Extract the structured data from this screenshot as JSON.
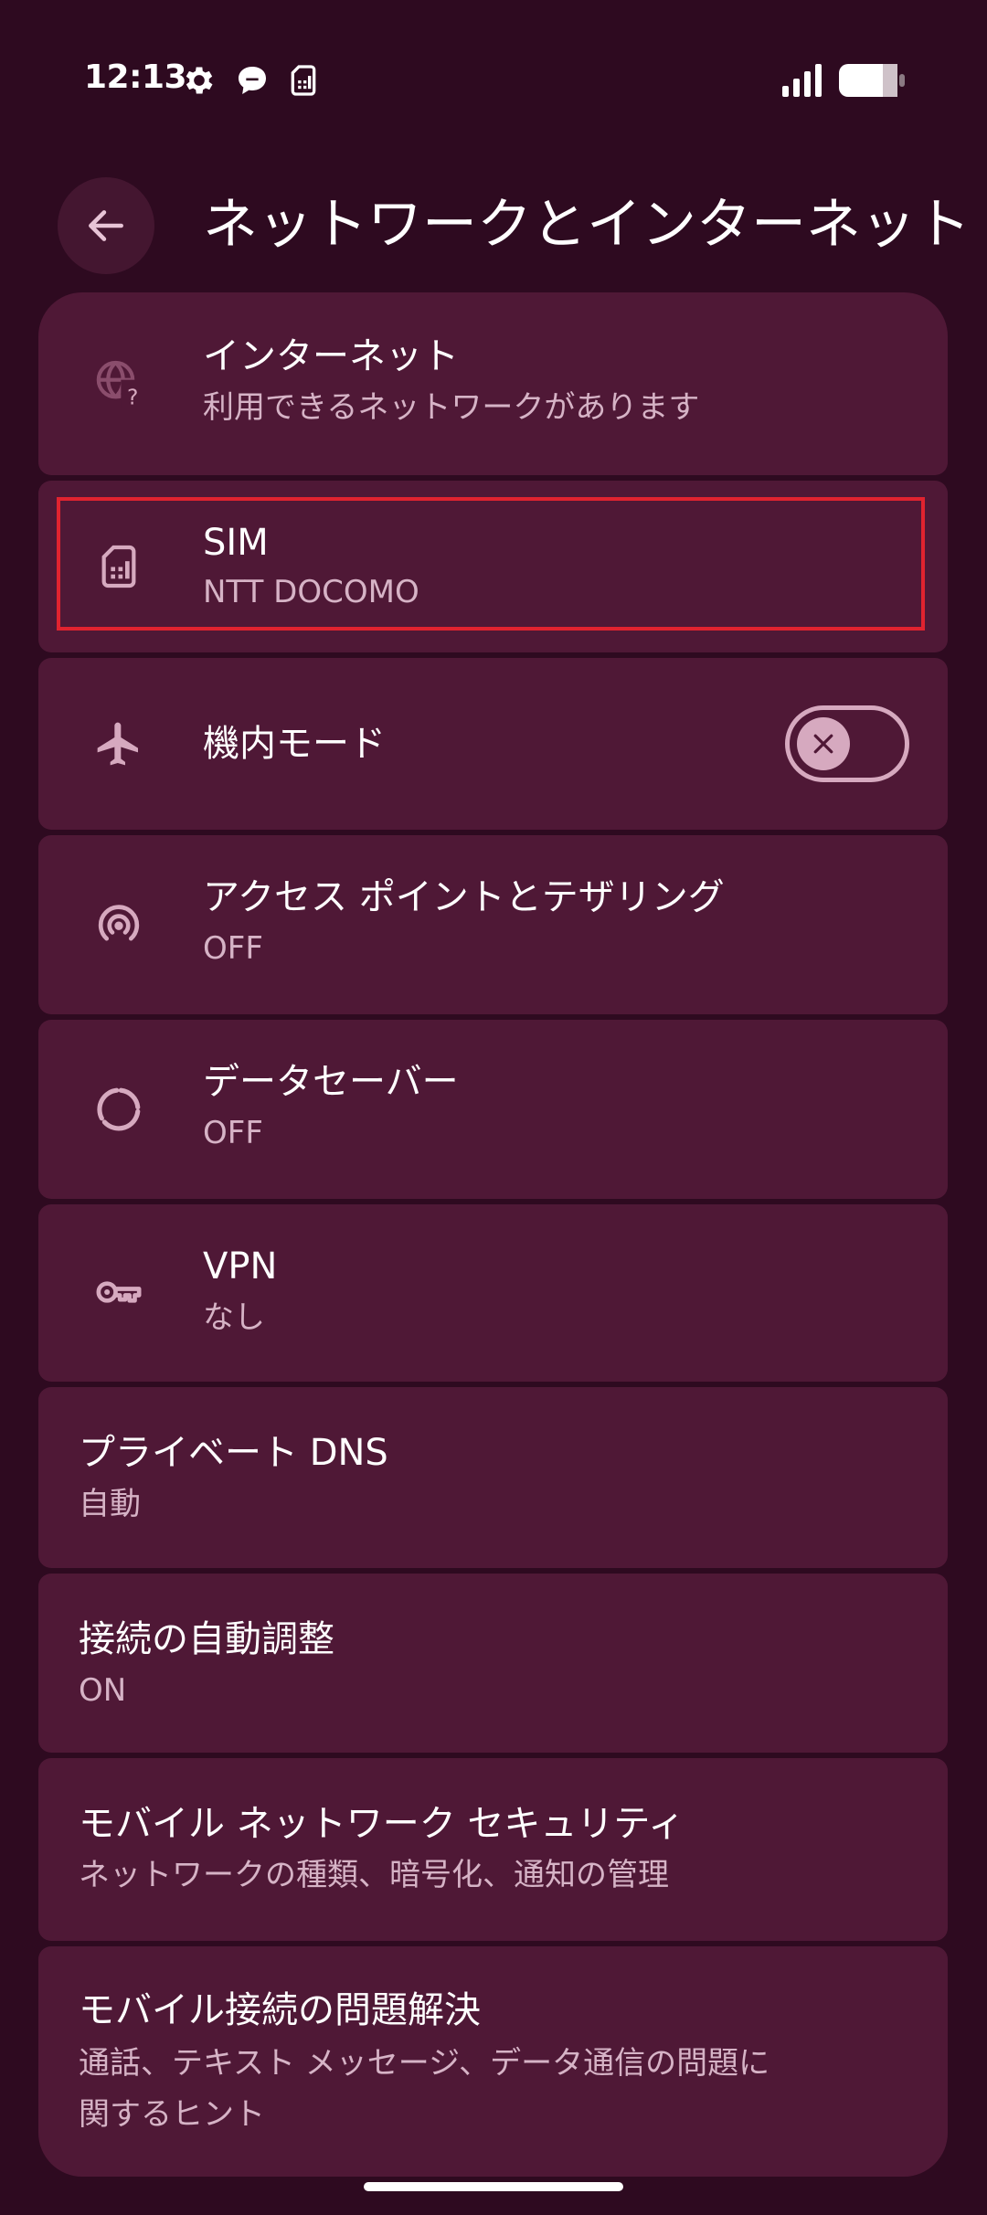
{
  "status_bar": {
    "time": "12:13",
    "icons": [
      "gear-icon",
      "chat-bubble-icon",
      "sim-card-icon",
      "signal-icon",
      "battery-icon"
    ]
  },
  "app_bar": {
    "back_icon": "arrow-back-icon",
    "title": "ネットワークとインターネット"
  },
  "items": [
    {
      "id": "internet",
      "icon": "globe-question-icon",
      "title": "インターネット",
      "subtitle": "利用できるネットワークがあります"
    },
    {
      "id": "sim",
      "icon": "sim-card-icon",
      "title": "SIM",
      "subtitle": "NTT DOCOMO",
      "highlighted": true
    },
    {
      "id": "airplane",
      "icon": "airplane-icon",
      "title": "機内モード",
      "toggle": {
        "on": false
      }
    },
    {
      "id": "hotspot",
      "icon": "hotspot-icon",
      "title": "アクセス ポイントとテザリング",
      "subtitle": "OFF"
    },
    {
      "id": "data-saver",
      "icon": "data-saver-icon",
      "title": "データセーバー",
      "subtitle": "OFF"
    },
    {
      "id": "vpn",
      "icon": "key-icon",
      "title": "VPN",
      "subtitle": "なし"
    },
    {
      "id": "private-dns",
      "title": "プライベート DNS",
      "subtitle": "自動"
    },
    {
      "id": "adaptive",
      "title": "接続の自動調整",
      "subtitle": "ON"
    },
    {
      "id": "mobile-security",
      "title": "モバイル ネットワーク セキュリティ",
      "subtitle": "ネットワークの種類、暗号化、通知の管理"
    },
    {
      "id": "troubleshoot",
      "title": "モバイル接続の問題解決",
      "subtitle_lines": [
        "通話、テキスト メッセージ、データ通信の問題に",
        "関するヒント"
      ]
    }
  ],
  "colors": {
    "background": "#2e0a20",
    "card": "#4f1836",
    "icon": "#d6a9bf",
    "highlight": "#e0232f"
  }
}
